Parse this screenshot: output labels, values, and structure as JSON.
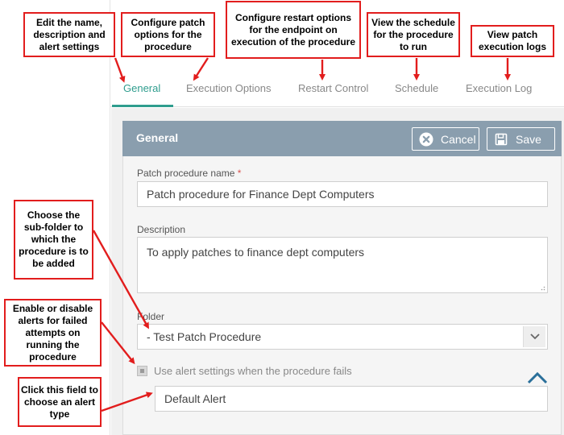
{
  "tabs": [
    {
      "label": "General",
      "active": true
    },
    {
      "label": "Execution Options",
      "active": false
    },
    {
      "label": "Restart Control",
      "active": false
    },
    {
      "label": "Schedule",
      "active": false
    },
    {
      "label": "Execution Log",
      "active": false
    }
  ],
  "panel": {
    "title": "General",
    "cancel_label": "Cancel",
    "save_label": "Save"
  },
  "form": {
    "name_label": "Patch procedure name",
    "required_mark": "*",
    "name_value": "Patch procedure for Finance Dept Computers",
    "description_label": "Description",
    "description_value": "To apply patches to finance dept computers",
    "folder_label": "Folder",
    "folder_value": "- Test Patch Procedure",
    "alert_checkbox_label": "Use alert settings when the procedure fails",
    "alert_value": "Default Alert"
  },
  "callouts": {
    "general": "Edit the name, description and alert settings",
    "execution": "Configure patch options for the procedure",
    "restart": "Configure restart options for the endpoint on execution of the procedure",
    "schedule": "View the schedule for the procedure to run",
    "log": "View patch execution logs",
    "folder": "Choose the sub-folder to which the procedure is to be added",
    "alerts": "Enable or disable alerts for failed attempts on running the procedure",
    "alert_type": "Click this field to choose an alert type"
  },
  "colors": {
    "accent": "#2f9d8e",
    "header": "#8a9eae",
    "callout_border": "#e21d1d"
  }
}
